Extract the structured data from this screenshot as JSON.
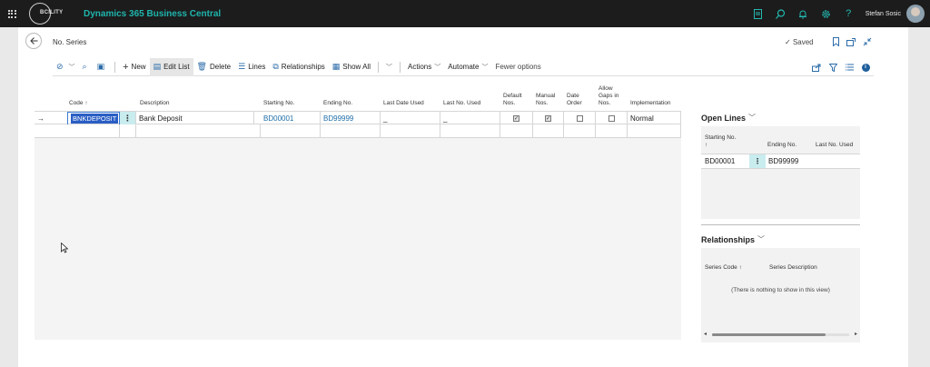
{
  "topbar": {
    "logo_text": "BCILITY",
    "app_title": "Dynamics 365 Business Central",
    "user_name": "Stefan Sosic",
    "icons": [
      "document-icon",
      "search-icon",
      "bell-icon",
      "gear-icon",
      "help-icon"
    ]
  },
  "header": {
    "title": "No. Series",
    "saved_label": "Saved"
  },
  "actions": {
    "new": "New",
    "edit_list": "Edit List",
    "delete": "Delete",
    "lines": "Lines",
    "relationships": "Relationships",
    "show_all": "Show All",
    "actions": "Actions",
    "automate": "Automate",
    "fewer_options": "Fewer options"
  },
  "grid": {
    "columns": {
      "code": "Code ↑",
      "description": "Description",
      "starting_no": "Starting No.",
      "ending_no": "Ending No.",
      "last_date_used": "Last Date Used",
      "last_no_used": "Last No. Used",
      "default_nos_1": "Default",
      "default_nos_2": "Nos.",
      "manual_nos_1": "Manual",
      "manual_nos_2": "Nos.",
      "date_order_1": "Date",
      "date_order_2": "Order",
      "allow_gaps_1": "Allow",
      "allow_gaps_2": "Gaps in",
      "allow_gaps_3": "Nos.",
      "implementation": "Implementation"
    },
    "rows": [
      {
        "code": "BNKDEPOSIT",
        "description": "Bank Deposit",
        "starting_no": "BD00001",
        "ending_no": "BD99999",
        "last_date_used": "_",
        "last_no_used": "_",
        "default_nos": true,
        "manual_nos": true,
        "date_order": false,
        "allow_gaps": false,
        "implementation": "Normal"
      }
    ]
  },
  "open_lines": {
    "title": "Open Lines",
    "col_starting_no": "Starting No.",
    "col_sort": "↑",
    "col_ending_no": "Ending No.",
    "col_last_no_used": "Last No. Used",
    "row": {
      "starting_no": "BD00001",
      "ending_no": "BD99999"
    }
  },
  "relationships": {
    "title": "Relationships",
    "col_series_code": "Series Code ↑",
    "col_series_description": "Series Description",
    "empty_message": "(There is nothing to show in this view)"
  },
  "colors": {
    "topbar_bg": "#1c1c1c",
    "app_title": "#1fb5ad",
    "link": "#1f6ea8",
    "selection": "#2a5ec4",
    "kebab_bg": "#c9ecef"
  }
}
